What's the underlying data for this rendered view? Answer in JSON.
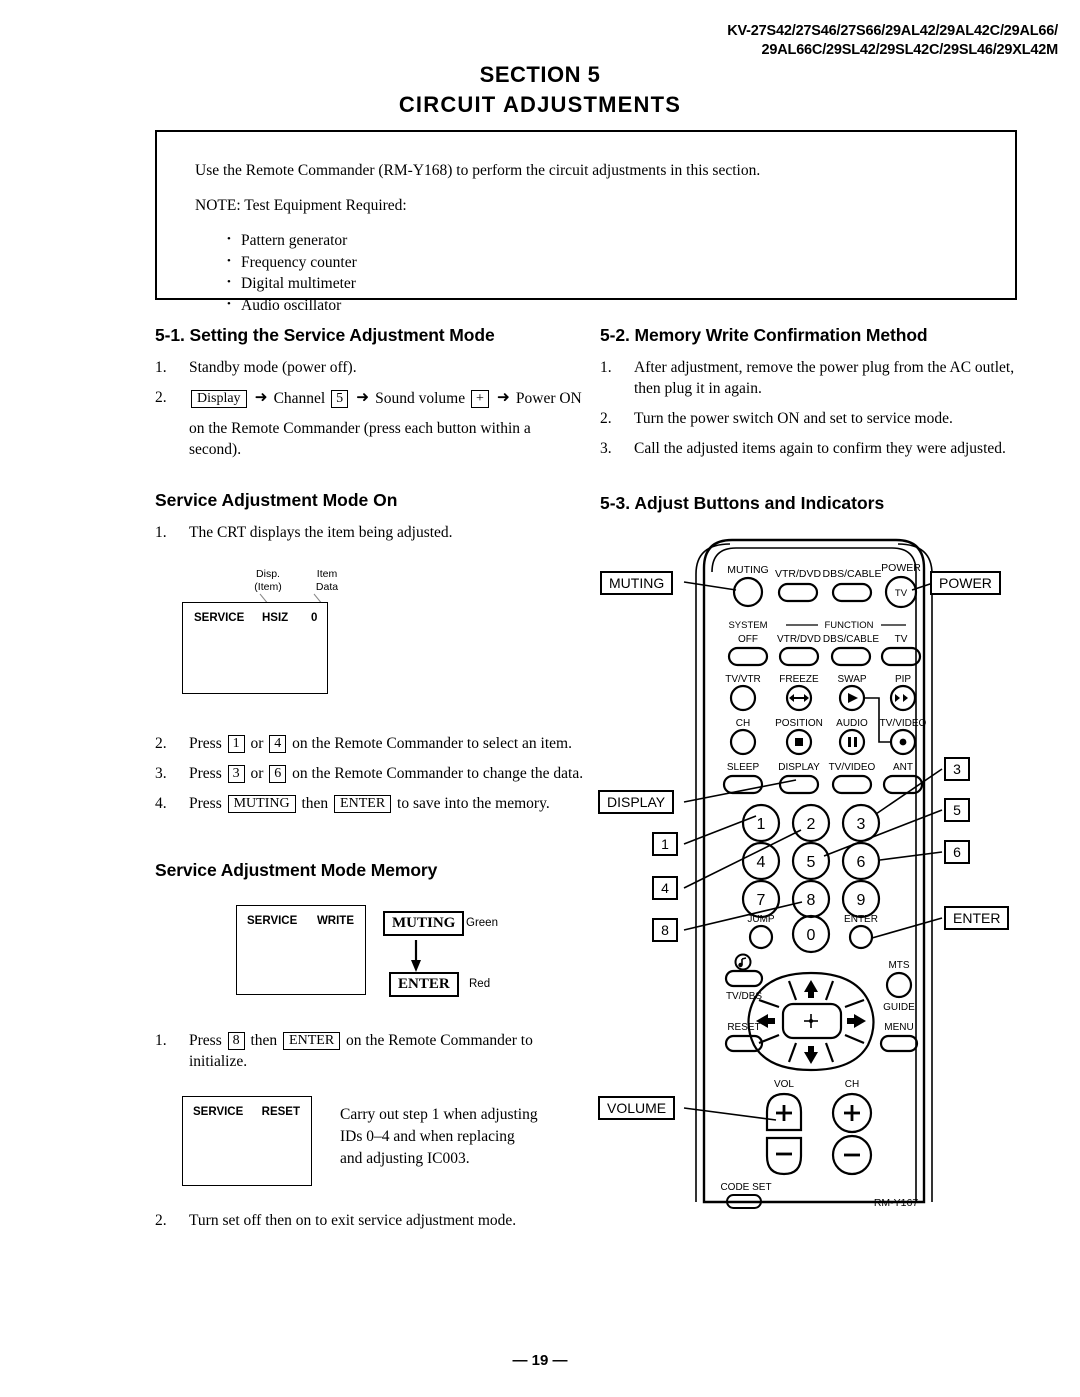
{
  "header": {
    "models_line1": "KV-27S42/27S46/27S66/29AL42/29AL42C/29AL66/",
    "models_line2": "29AL66C/29SL42/29SL42C/29SL46/29XL42M"
  },
  "title": {
    "line1": "SECTION  5",
    "line2": "CIRCUIT  ADJUSTMENTS"
  },
  "intro": {
    "paragraph": "Use the Remote Commander (RM-Y168) to perform  the circuit adjustments in this section.",
    "note_label": "NOTE: Test Equipment Required:",
    "equipment": [
      "Pattern generator",
      "Frequency counter",
      "Digital multimeter",
      "Audio oscillator"
    ]
  },
  "section_5_1": {
    "heading": "5-1. Setting the Service Adjustment Mode",
    "step1_num": "1.",
    "step1_text": "Standby mode (power off).",
    "step2_num": "2.",
    "step2_key_display": "Display",
    "step2_word_channel": "Channel",
    "step2_key_5": "5",
    "step2_word_volume": "Sound volume",
    "step2_key_plus": "+",
    "step2_word_power": "Power ON",
    "step2_cont": "on the Remote Commander (press each button within a second)."
  },
  "mode_on": {
    "heading": "Service Adjustment Mode On",
    "step1_num": "1.",
    "step1_text": "The CRT displays the item being adjusted.",
    "callout_left_l1": "Disp.",
    "callout_left_l2": "(Item)",
    "callout_right_l1": "Item",
    "callout_right_l2": "Data",
    "crt_service": "SERVICE",
    "crt_item": "HSIZ",
    "crt_data": "0",
    "step2_num": "2.",
    "step2_a": "Press",
    "step2_k1": "1",
    "step2_or": "or",
    "step2_k2": "4",
    "step2_b": "on the Remote Commander to select an item.",
    "step3_num": "3.",
    "step3_a": "Press",
    "step3_k1": "3",
    "step3_or": "or",
    "step3_k2": "6",
    "step3_b": "on the Remote Commander to change the data.",
    "step4_num": "4.",
    "step4_a": "Press",
    "step4_k1": "MUTING",
    "step4_then": "then",
    "step4_k2": "ENTER",
    "step4_b": "to save into the memory."
  },
  "mode_memory": {
    "heading": "Service Adjustment Mode Memory",
    "crt_service": "SERVICE",
    "crt_write": "WRITE",
    "key_muting": "MUTING",
    "label_green": "Green",
    "key_enter": "ENTER",
    "label_red": "Red",
    "step1_num": "1.",
    "step1_a": "Press",
    "step1_k1": "8",
    "step1_then": "then",
    "step1_k2": "ENTER",
    "step1_b": "on the Remote Commander to initialize.",
    "crt_reset_service": "SERVICE",
    "crt_reset_label": "RESET",
    "note_l1": "Carry out step 1 when adjusting",
    "note_l2": "IDs 0–4 and when replacing",
    "note_l3": "and adjusting IC003.",
    "step2_num": "2.",
    "step2_text": "Turn set off then on to exit service adjustment mode."
  },
  "section_5_2": {
    "heading": "5-2. Memory Write Confirmation Method",
    "steps": [
      {
        "num": "1.",
        "text": "After adjustment, remove the power plug from the AC outlet, then plug it in again."
      },
      {
        "num": "2.",
        "text": "Turn the power switch ON and set to service mode."
      },
      {
        "num": "3.",
        "text": "Call the adjusted items again to confirm they were adjusted."
      }
    ]
  },
  "section_5_3": {
    "heading": "5-3. Adjust Buttons and Indicators",
    "remote": {
      "model": "RM-Y167",
      "callouts_left": [
        "MUTING",
        "DISPLAY",
        "1",
        "4",
        "8",
        "VOLUME"
      ],
      "callouts_right": [
        "POWER",
        "3",
        "5",
        "6",
        "ENTER"
      ],
      "row_top": [
        "MUTING",
        "VTR/DVD",
        "DBS/CABLE",
        "POWER"
      ],
      "power_tv": "TV",
      "group_system": "SYSTEM",
      "group_function": "FUNCTION",
      "row_func": [
        "OFF",
        "VTR/DVD",
        "DBS/CABLE",
        "TV"
      ],
      "row_b": [
        "TV/VTR",
        "FREEZE",
        "SWAP",
        "PIP"
      ],
      "row_c": [
        "CH",
        "POSITION",
        "AUDIO",
        "TV/VIDEO"
      ],
      "row_d": [
        "SLEEP",
        "DISPLAY",
        "TV/VIDEO",
        "ANT"
      ],
      "keypad": [
        "1",
        "2",
        "3",
        "4",
        "5",
        "6",
        "7",
        "8",
        "9"
      ],
      "key_jump": "JUMP",
      "key_zero": "0",
      "key_enter": "ENTER",
      "key_tvdbs": "TV/DBS",
      "key_mts": "MTS",
      "key_guide": "GUIDE",
      "key_reset": "RESET",
      "key_menu": "MENU",
      "key_vol": "VOL",
      "key_ch": "CH",
      "key_codeset": "CODE SET"
    }
  },
  "footer": {
    "page": "— 19 —"
  }
}
